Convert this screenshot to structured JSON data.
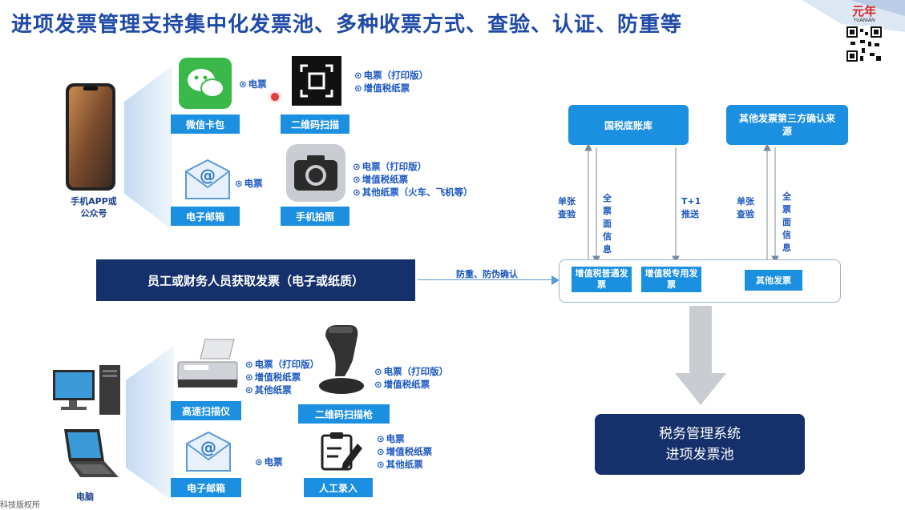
{
  "title": "进项发票管理支持集中化发票池、多种收票方式、查验、认证、防重等",
  "logo": {
    "text": "元年",
    "sub": "YUANIAN"
  },
  "mobile": {
    "label_line1": "手机APP或",
    "label_line2": "公众号"
  },
  "wechat": {
    "label": "微信卡包",
    "bullets": [
      "电票"
    ]
  },
  "qrscan": {
    "label": "二维码扫描",
    "bullets": [
      "电票（打印版）",
      "增值税纸票"
    ]
  },
  "email_top": {
    "label": "电子邮箱",
    "bullets": [
      "电票"
    ]
  },
  "photo": {
    "label": "手机拍照",
    "bullets": [
      "电票（打印版）",
      "增值税纸票",
      "其他纸票（火车、飞机等）"
    ]
  },
  "employee_box": "员工或财务人员获取发票（电子或纸质）",
  "arrow_label": "防重、防伪确认",
  "tax_db": "国税底账库",
  "third_party": "其他发票第三方确认来源",
  "links": {
    "single_check_1": "单张查验",
    "full_info_1": "全票面信息",
    "t1_push": "T+1推送",
    "single_check_2": "单张查验",
    "full_info_2": "全票面信息"
  },
  "invoice_types": [
    "增值税普通发票",
    "增值税专用发票",
    "其他发票"
  ],
  "scanner": {
    "label": "高速扫描仪",
    "bullets": [
      "电票（打印版）",
      "增值税纸票",
      "其他纸票"
    ]
  },
  "scan_gun": {
    "label": "二维码扫描枪",
    "bullets": [
      "电票（打印版）",
      "增值税纸票"
    ]
  },
  "email_bottom": {
    "label": "电子邮箱",
    "bullets": [
      "电票"
    ]
  },
  "manual": {
    "label": "人工录入",
    "bullets": [
      "电票",
      "增值税纸票",
      "其他纸票"
    ]
  },
  "computer_label": "电脑",
  "result_box": {
    "line1": "税务管理系统",
    "line2": "进项发票池"
  },
  "footer": "科技版权所"
}
